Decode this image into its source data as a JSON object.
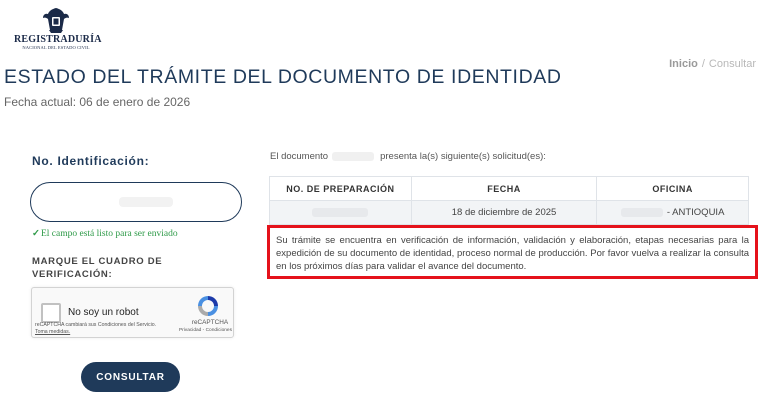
{
  "header": {
    "logo_name": "REGISTRADURÍA",
    "logo_subtitle": "NACIONAL DEL ESTADO CIVIL",
    "logo_icon": "coat-of-arms-icon"
  },
  "breadcrumb": {
    "home": "Inicio",
    "separator": "/",
    "current": "Consultar"
  },
  "page": {
    "title": "ESTADO DEL TRÁMITE DEL DOCUMENTO DE IDENTIDAD",
    "current_date": "Fecha actual: 06 de enero de 2026"
  },
  "form": {
    "id_label": "No. Identificación:",
    "id_value": "",
    "valid_check": "✓",
    "valid_message": "El campo está listo para ser enviado",
    "verify_label": "MARQUE EL CUADRO DE VERIFICACIÓN:",
    "submit_label": "CONSULTAR"
  },
  "recaptcha": {
    "label": "No soy un robot",
    "note_prefix": "reCAPTCHA cambiará sus Condiciones del Servicio.",
    "note_link": "Toma medidas.",
    "brand": "reCAPTCHA",
    "links": "Privacidad - Condiciones"
  },
  "results": {
    "intro_prefix": "El documento",
    "intro_suffix": "presenta la(s) siguiente(s) solicitud(es):",
    "columns": [
      "NO. DE PREPARACIÓN",
      "FECHA",
      "OFICINA"
    ],
    "rows": [
      {
        "preparation": "",
        "date": "18 de diciembre de 2025",
        "office": "- ANTIOQUIA"
      }
    ],
    "status_message": "Su trámite se encuentra en verificación de información, validación y elaboración, etapas necesarias para la expedición de su documento de identidad, proceso normal de producción. Por favor vuelva a realizar la consulta en los próximos días para validar el avance del documento."
  },
  "colors": {
    "primary": "#1f3a5a",
    "success": "#2e9a48",
    "highlight": "#e5121b"
  }
}
